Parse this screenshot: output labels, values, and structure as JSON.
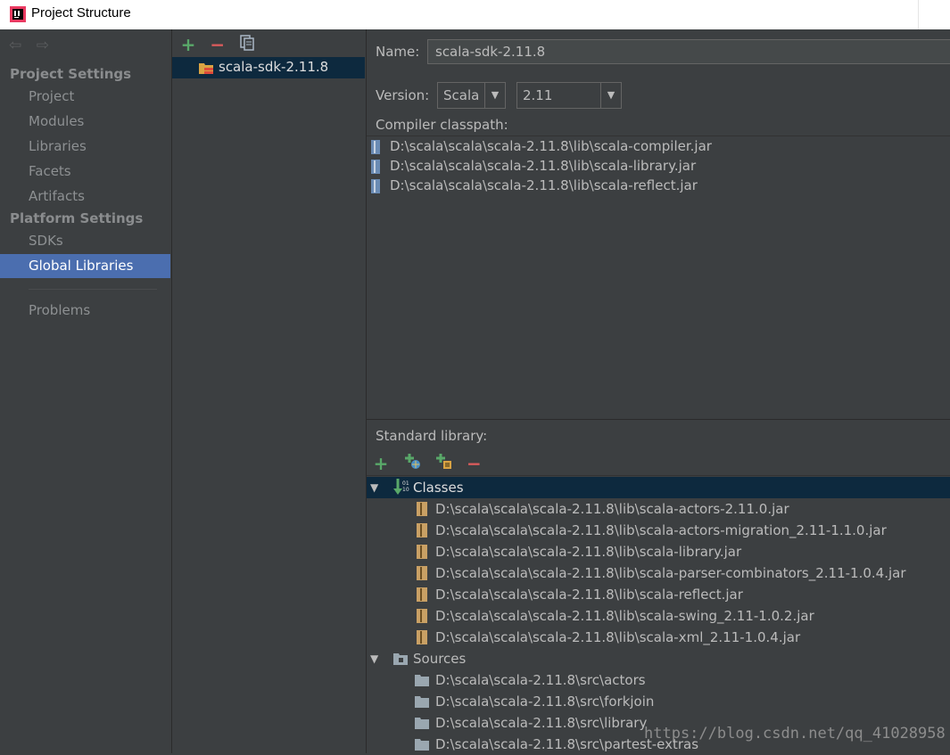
{
  "window": {
    "title": "Project Structure"
  },
  "nav": {
    "project_settings_header": "Project Settings",
    "project_items": [
      "Project",
      "Modules",
      "Libraries",
      "Facets",
      "Artifacts"
    ],
    "platform_settings_header": "Platform Settings",
    "platform_items": [
      "SDKs",
      "Global Libraries"
    ],
    "selected": "Global Libraries",
    "problems": "Problems"
  },
  "libraries": {
    "items": [
      "scala-sdk-2.11.8"
    ]
  },
  "details": {
    "name_label": "Name:",
    "name_value": "scala-sdk-2.11.8",
    "version_label": "Version:",
    "version_kind": "Scala",
    "version_value": "2.11",
    "compiler_classpath_label": "Compiler classpath:",
    "compiler_classpath": [
      "D:\\scala\\scala\\scala-2.11.8\\lib\\scala-compiler.jar",
      "D:\\scala\\scala\\scala-2.11.8\\lib\\scala-library.jar",
      "D:\\scala\\scala\\scala-2.11.8\\lib\\scala-reflect.jar"
    ],
    "standard_library_label": "Standard library:",
    "classes_label": "Classes",
    "classes": [
      "D:\\scala\\scala\\scala-2.11.8\\lib\\scala-actors-2.11.0.jar",
      "D:\\scala\\scala\\scala-2.11.8\\lib\\scala-actors-migration_2.11-1.1.0.jar",
      "D:\\scala\\scala\\scala-2.11.8\\lib\\scala-library.jar",
      "D:\\scala\\scala\\scala-2.11.8\\lib\\scala-parser-combinators_2.11-1.0.4.jar",
      "D:\\scala\\scala\\scala-2.11.8\\lib\\scala-reflect.jar",
      "D:\\scala\\scala\\scala-2.11.8\\lib\\scala-swing_2.11-1.0.2.jar",
      "D:\\scala\\scala\\scala-2.11.8\\lib\\scala-xml_2.11-1.0.4.jar"
    ],
    "sources_label": "Sources",
    "sources": [
      "D:\\scala\\scala-2.11.8\\src\\actors",
      "D:\\scala\\scala-2.11.8\\src\\forkjoin",
      "D:\\scala\\scala-2.11.8\\src\\library",
      "D:\\scala\\scala-2.11.8\\src\\partest-extras"
    ]
  },
  "watermark": "https://blog.csdn.net/qq_41028958",
  "colors": {
    "selection": "#4b6eaf",
    "tree_selection": "#0d293e",
    "add": "#59a869",
    "remove": "#db5c5c"
  }
}
